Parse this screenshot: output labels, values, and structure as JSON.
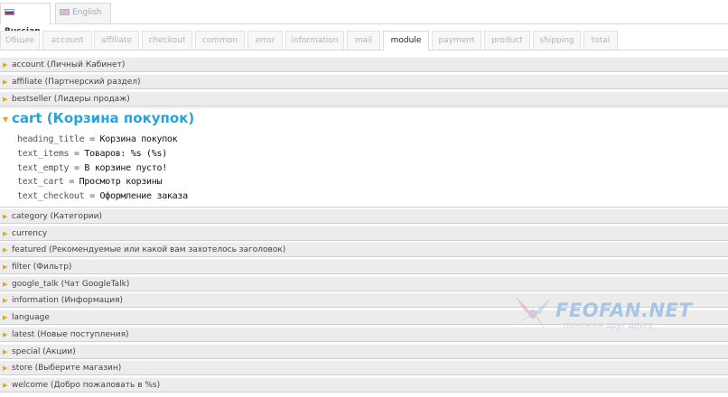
{
  "languages": [
    {
      "label": "Russian",
      "active": true,
      "flag": "ru-flag-icon"
    },
    {
      "label": "English",
      "active": false,
      "flag": "en-flag-icon"
    }
  ],
  "file_tabs": [
    {
      "label": "Общее"
    },
    {
      "label": "account"
    },
    {
      "label": "affiliate"
    },
    {
      "label": "checkout"
    },
    {
      "label": "common"
    },
    {
      "label": "error"
    },
    {
      "label": "information"
    },
    {
      "label": "mail"
    },
    {
      "label": "module",
      "active": true
    },
    {
      "label": "payment"
    },
    {
      "label": "product"
    },
    {
      "label": "shipping"
    },
    {
      "label": "total"
    }
  ],
  "sections_before": [
    {
      "label": "account (Личный Кабинет)"
    },
    {
      "label": "affiliate (Партнерский раздел)"
    },
    {
      "label": "bestseller (Лидеры продаж)"
    }
  ],
  "expanded": {
    "title": "cart (Корзина покупок)",
    "entries": [
      {
        "key": "heading_title",
        "value": "Корзина покупок"
      },
      {
        "key": "text_items",
        "value": "Товаров: %s (%s)"
      },
      {
        "key": "text_empty",
        "value": "В корзине пусто!"
      },
      {
        "key": "text_cart",
        "value": "Просмотр корзины"
      },
      {
        "key": "text_checkout",
        "value": "Оформление заказа"
      }
    ]
  },
  "sections_after": [
    {
      "label": "category (Категории)"
    },
    {
      "label": "currency"
    },
    {
      "label": "featured (Рекомендуемые или какой вам захотелось заголовок)"
    },
    {
      "label": "filter (Фильтр)"
    },
    {
      "label": "google_talk (Чат GoogleTalk)"
    },
    {
      "label": "information (Информация)"
    },
    {
      "label": "language"
    },
    {
      "label": "latest (Новые поступления)"
    },
    {
      "label": "special (Акции)"
    },
    {
      "label": "store (Выберите магазин)"
    },
    {
      "label": "welcome (Добро пожаловать в %s)"
    }
  ],
  "watermark": {
    "title": "FEOFAN.NET",
    "subtitle": "поможем друг другу"
  },
  "colors": {
    "accent": "#2aa2d8",
    "arrow": "#e7a31e",
    "row_bg": "#ececec"
  }
}
